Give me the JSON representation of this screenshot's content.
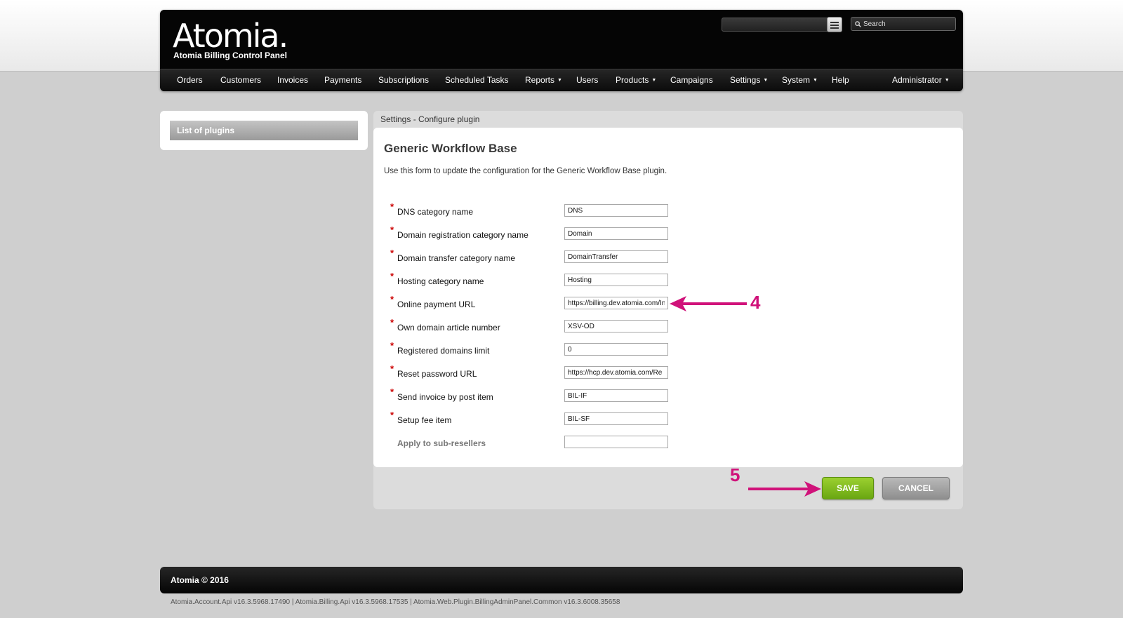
{
  "header": {
    "logo_text": "Atomia.",
    "subtitle": "Atomia Billing Control Panel",
    "search_placeholder": "Search"
  },
  "nav": {
    "items": [
      {
        "label": "Orders",
        "has_caret": false
      },
      {
        "label": "Customers",
        "has_caret": false
      },
      {
        "label": "Invoices",
        "has_caret": false
      },
      {
        "label": "Payments",
        "has_caret": false
      },
      {
        "label": "Subscriptions",
        "has_caret": false
      },
      {
        "label": "Scheduled Tasks",
        "has_caret": false
      },
      {
        "label": "Reports",
        "has_caret": true
      },
      {
        "label": "Users",
        "has_caret": false
      },
      {
        "label": "Products",
        "has_caret": true
      },
      {
        "label": "Campaigns",
        "has_caret": false
      },
      {
        "label": "Settings",
        "has_caret": true
      },
      {
        "label": "System",
        "has_caret": true
      },
      {
        "label": "Help",
        "has_caret": false
      }
    ],
    "user_menu": "Administrator"
  },
  "sidebar": {
    "items": [
      {
        "label": "List of plugins"
      }
    ]
  },
  "main": {
    "breadcrumb": "Settings - Configure plugin",
    "title": "Generic Workflow Base",
    "description": "Use this form to update the configuration for the Generic Workflow Base plugin.",
    "fields": [
      {
        "label": "DNS category name",
        "value": "DNS",
        "required": true
      },
      {
        "label": "Domain registration category name",
        "value": "Domain",
        "required": true
      },
      {
        "label": "Domain transfer category name",
        "value": "DomainTransfer",
        "required": true
      },
      {
        "label": "Hosting category name",
        "value": "Hosting",
        "required": true
      },
      {
        "label": "Online payment URL",
        "value": "https://billing.dev.atomia.com/In",
        "required": true
      },
      {
        "label": "Own domain article number",
        "value": "XSV-OD",
        "required": true
      },
      {
        "label": "Registered domains limit",
        "value": "0",
        "required": true
      },
      {
        "label": "Reset password URL",
        "value": "https://hcp.dev.atomia.com/Re",
        "required": true
      },
      {
        "label": "Send invoice by post item",
        "value": "BIL-IF",
        "required": true
      },
      {
        "label": "Setup fee item",
        "value": "BIL-SF",
        "required": true
      },
      {
        "label": "Apply to sub-resellers",
        "value": "",
        "required": false
      }
    ],
    "save_label": "SAVE",
    "cancel_label": "CANCEL"
  },
  "annotations": {
    "step4": "4",
    "step5": "5",
    "color": "#d0127a"
  },
  "footer": {
    "copyright": "Atomia © 2016",
    "versions": "Atomia.Account.Api v16.3.5968.17490 | Atomia.Billing.Api v16.3.5968.17535 | Atomia.Web.Plugin.BillingAdminPanel.Common v16.3.6008.35658"
  }
}
